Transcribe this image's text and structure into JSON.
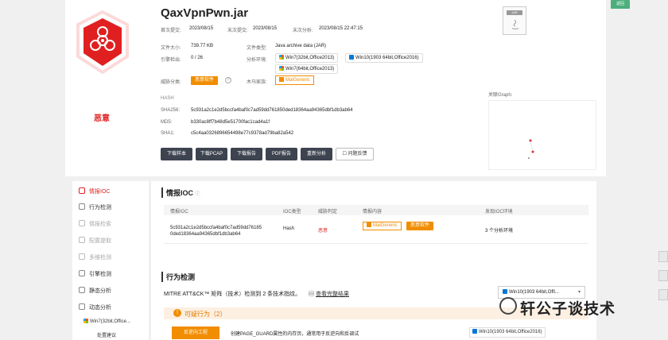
{
  "file": {
    "title": "QaxVpnPwn.jar",
    "first_submit_label": "首次提交:",
    "first_submit": "2023/08/15",
    "last_submit_label": "末次提交:",
    "last_submit": "2023/08/15",
    "last_analysis_label": "末次分析:",
    "last_analysis": "2023/08/15 22:47:15",
    "size_label": "文件大小:",
    "size": "739.77 KB",
    "type_label": "文件类型:",
    "type": "Java archive data (JAR)",
    "engine_label": "引擎检出:",
    "engine": "0 / 26",
    "env_label": "分析环境:",
    "envs": [
      "Win7(32bit,Office2013)",
      "Win10(1903 64bit,Office2016)",
      "Win7(64bit,Office2013)"
    ],
    "threat_class_label": "威胁分类:",
    "threat_class": "恶意软件",
    "family_label": "木马家族:",
    "family": "MalGeneric",
    "verdict": "恶意",
    "hash_label": "HASH",
    "sha256_label": "SHA256:",
    "sha256": "5c931a2c1e2d5bccfa4baf0c7ad59dd761850ded18364aa94365dbf1db3ab64",
    "md5_label": "MD5:",
    "md5": "b330ac8ff7b48d5e51700fac1cad4a1f",
    "sha1_label": "SHA1:",
    "sha1": "c5c4aa0326896654498e77c9378ad79ba82a542",
    "jar_badge": "JAR"
  },
  "buttons": {
    "download_sample": "下载样本",
    "download_pcap": "下载PCAP",
    "download_report": "下载报告",
    "pdf_report": "PDF报告",
    "reanalyze": "重新分析",
    "feedback": "问题反馈"
  },
  "graph_label": "关联Graph:",
  "corner_badge": "返回",
  "sidebar": {
    "items": [
      {
        "label": "情报IOC"
      },
      {
        "label": "行为检测"
      },
      {
        "label": "情报检索"
      },
      {
        "label": "配置提取"
      },
      {
        "label": "多维检测"
      },
      {
        "label": "引擎检测"
      },
      {
        "label": "静态分析"
      },
      {
        "label": "动态分析"
      }
    ],
    "sub_env": "Win7(32bit,Office...",
    "sub_item": "处置建议"
  },
  "ioc": {
    "title": "情报IOC",
    "headers": [
      "情报IOC",
      "IOC类型",
      "威胁判定",
      "情报内容",
      "发现IOC环境"
    ],
    "row": {
      "ioc": "5c931a2c1e2d5bccfa4baf0c7ad59dd76185",
      "ioc2": "0ded18364aa94365dbf1db3ab64",
      "type": "Hash",
      "verdict": "恶意",
      "tag1": "MalGeneric",
      "tag2": "恶意软件",
      "env": "3 个分析环境"
    }
  },
  "behavior": {
    "title": "行为检测",
    "mitre_text": "MITRE ATT&CK™ 矩阵（技术）检测到 2 条技术指纹。",
    "full_result": "查看完整结果",
    "select_value": "Win10(1903 64bit,Offi...",
    "suspicious": "可疑行为（2）",
    "anti_label": "反逆向工程",
    "desc": "创建PAGE_GUARD属性的内存页，通常用于反逆向和反调试",
    "desc_env": "Win10(1903 64bit,Office2016)"
  },
  "watermark": "轩公子谈技术"
}
